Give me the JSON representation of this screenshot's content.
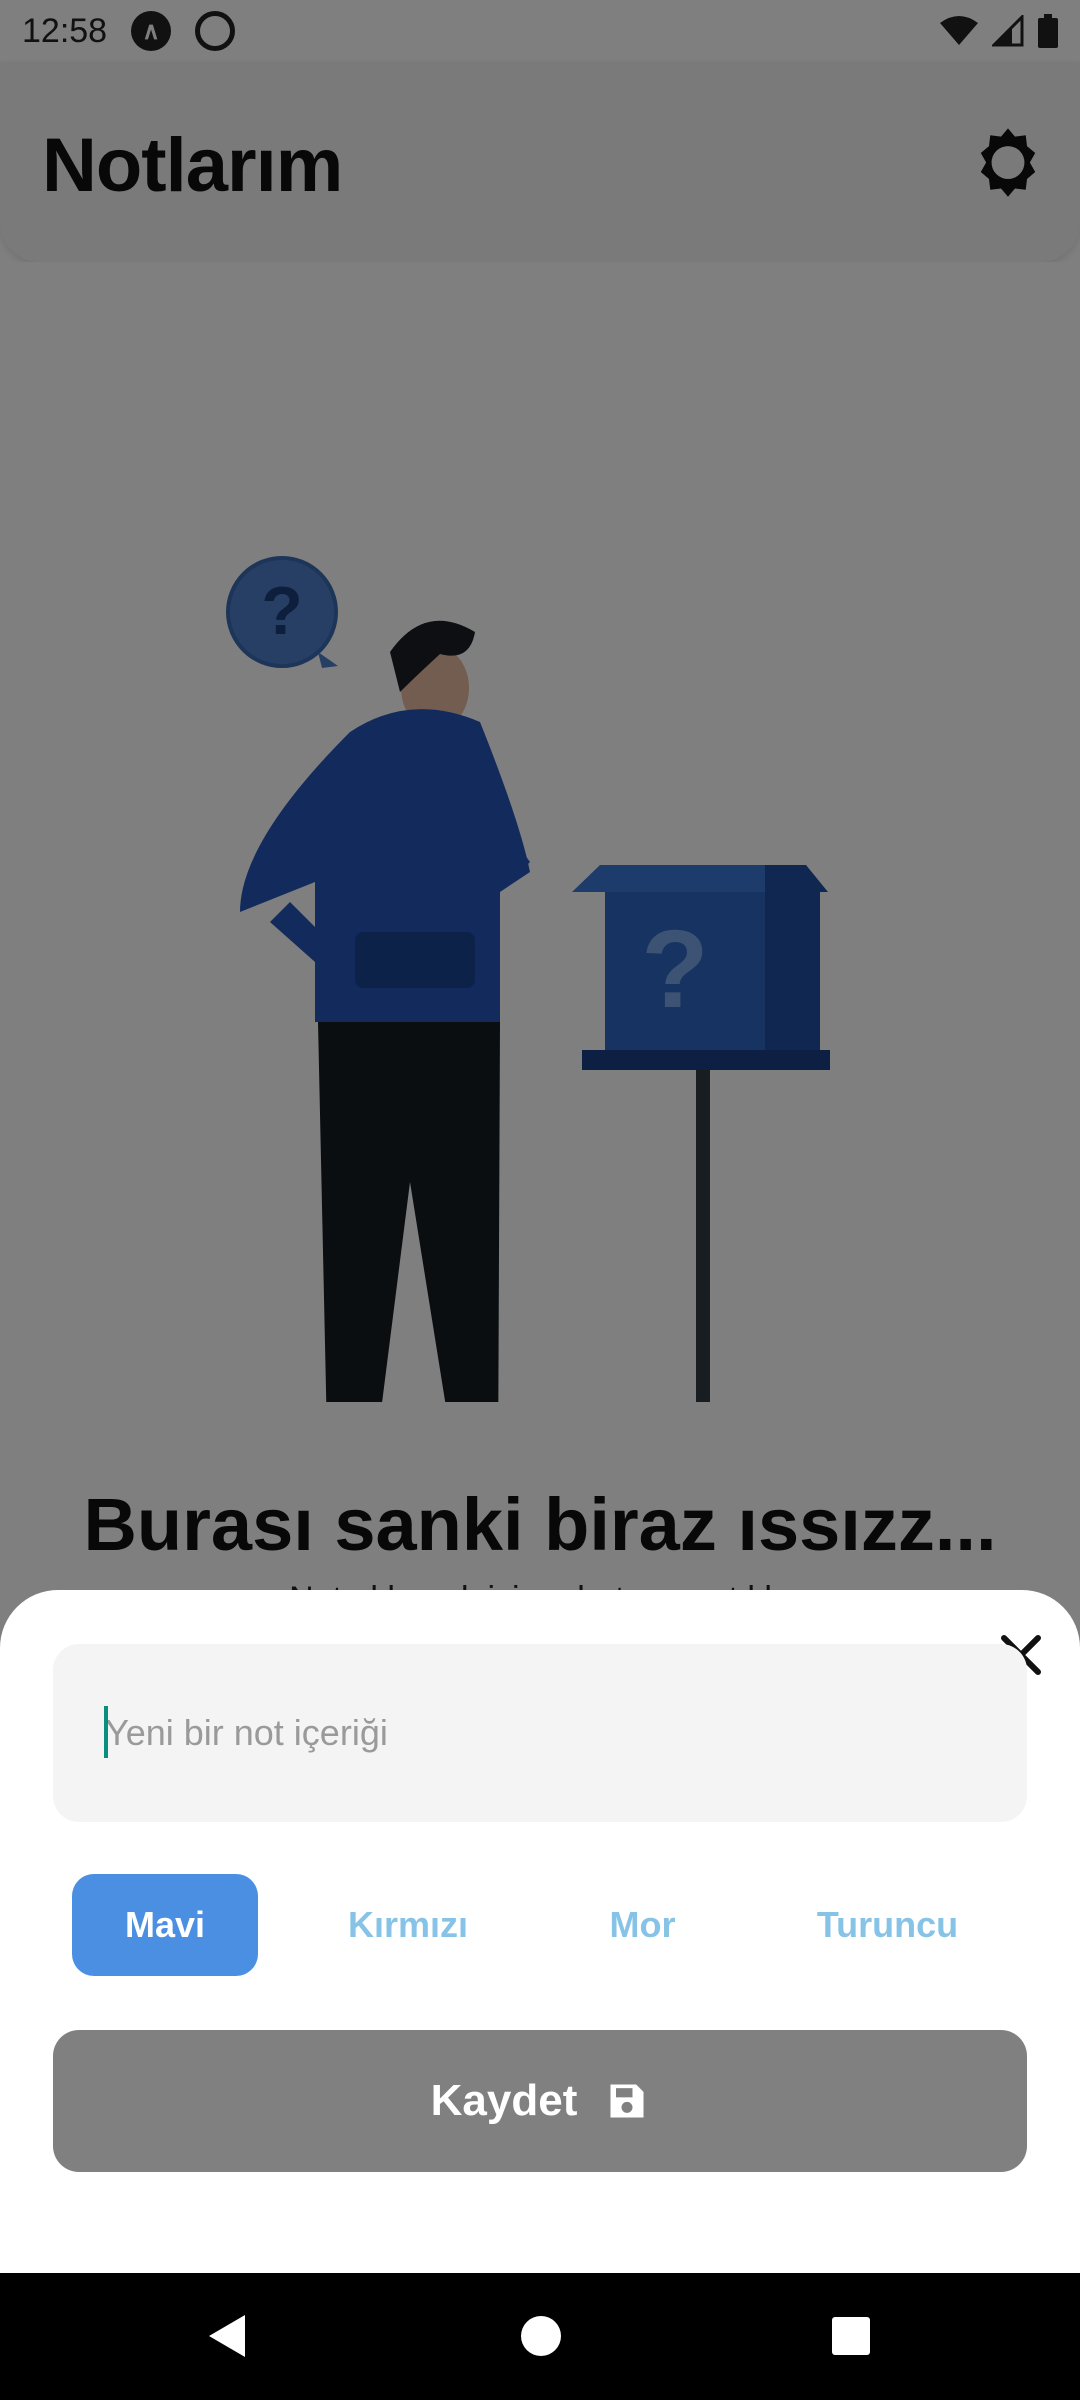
{
  "status_bar": {
    "time": "12:58",
    "icons": [
      "a-logo-icon",
      "no-sign-icon",
      "wifi-icon",
      "signal-icon",
      "battery-icon"
    ]
  },
  "header": {
    "title": "Notlarım",
    "settings_icon": "gear-icon"
  },
  "empty_state": {
    "title": "Burası sanki biraz ıssızz...",
    "subtitle": "Not eklemek için + butonuna tıkla"
  },
  "sheet": {
    "note_input": {
      "placeholder": "Yeni bir not içeriği",
      "value": ""
    },
    "colors": [
      {
        "label": "Mavi",
        "selected": true
      },
      {
        "label": "Kırmızı",
        "selected": false
      },
      {
        "label": "Mor",
        "selected": false
      },
      {
        "label": "Turuncu",
        "selected": false
      }
    ],
    "save_label": "Kaydet",
    "save_icon": "floppy-disk-icon",
    "close_icon": "close-icon"
  },
  "nav": {
    "back": "back-icon",
    "home": "home-icon",
    "recents": "recents-icon"
  },
  "colors": {
    "accent_blue": "#4a8fe2",
    "chip_text_light": "#86c3e6",
    "save_button": "#808080",
    "caret": "#0a8f7e"
  }
}
